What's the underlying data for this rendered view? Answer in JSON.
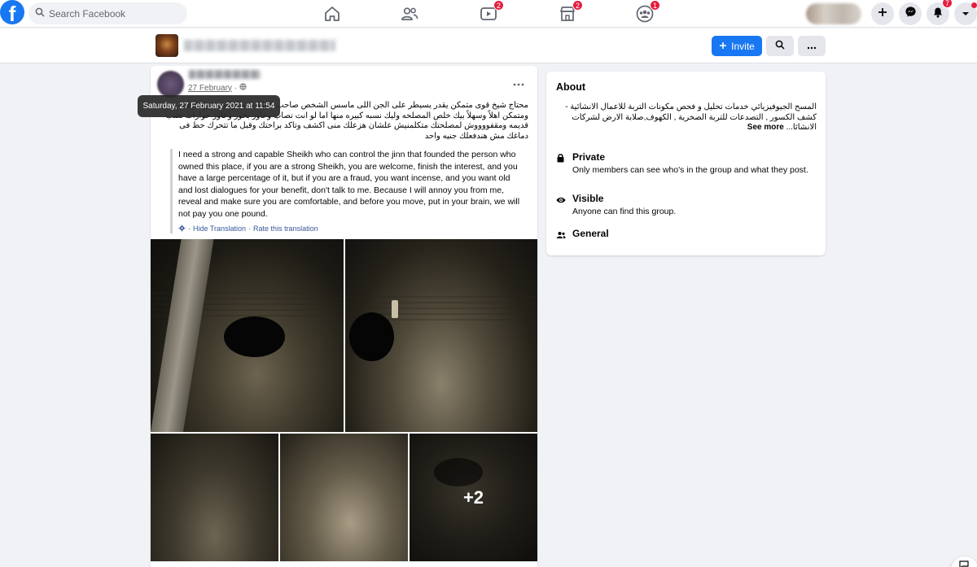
{
  "search": {
    "placeholder": "Search Facebook"
  },
  "nav": {
    "badges": {
      "watch": "2",
      "marketplace": "2",
      "groups": "1",
      "notifications": "7"
    }
  },
  "group": {
    "invite_label": "Invite"
  },
  "post": {
    "date": "27 February",
    "tooltip": "Saturday, 27 February 2021 at 11:54",
    "arabic_text": "محتاج شيخ قوى متمكن يقدر يسيطر على الجن اللى ماسس الشخص صاحب المكان ده لو انت شيخ قوى ومتمكن اهلاً وسهلاً بيك خلص  المصلحه وليك نسبه كبيره منها اما لو انت نصاب وعاوز بخور وعاوز حوارات نصب قديمه ومقفووووش لمصلحتك متكلمنيش علشان هزعلك منى اكشف وتاكد براحتك وقبل ما تتحرك حط فى دماغك مش هندفعلك جنيه واحد",
    "translation": "I need a strong and capable Sheikh who can control the jinn that founded the person who owned this place, if you are a strong Sheikh, you are welcome, finish the interest, and you have a large percentage of it, but if you are a fraud, you want incense, and you want old and lost dialogues for your benefit, don't talk to me. Because I will annoy you from me, reveal and make sure you are comfortable, and before you move, put in your brain, we will not pay you one pound.",
    "hide_translation": "Hide Translation",
    "rate_translation": "Rate this translation",
    "separator": "·",
    "more_photos": "+2"
  },
  "about": {
    "title": "About",
    "description": "المسح الجيوفيزيائي خدمات تحليل و فحص مكونات التربة للاعمال الانشائية - كشف الكسور , التصدعات للتربة الصخرية , الكهوف,صلابة الارض لشركات الانشائا...",
    "see_more": "See more",
    "privacy_title": "Private",
    "privacy_desc": "Only members can see who's in the group and what they post.",
    "visibility_title": "Visible",
    "visibility_desc": "Anyone can find this group.",
    "category": "General"
  },
  "colors": {
    "brand": "#1877f2",
    "badge": "#e41e3f",
    "link": "#385898"
  }
}
